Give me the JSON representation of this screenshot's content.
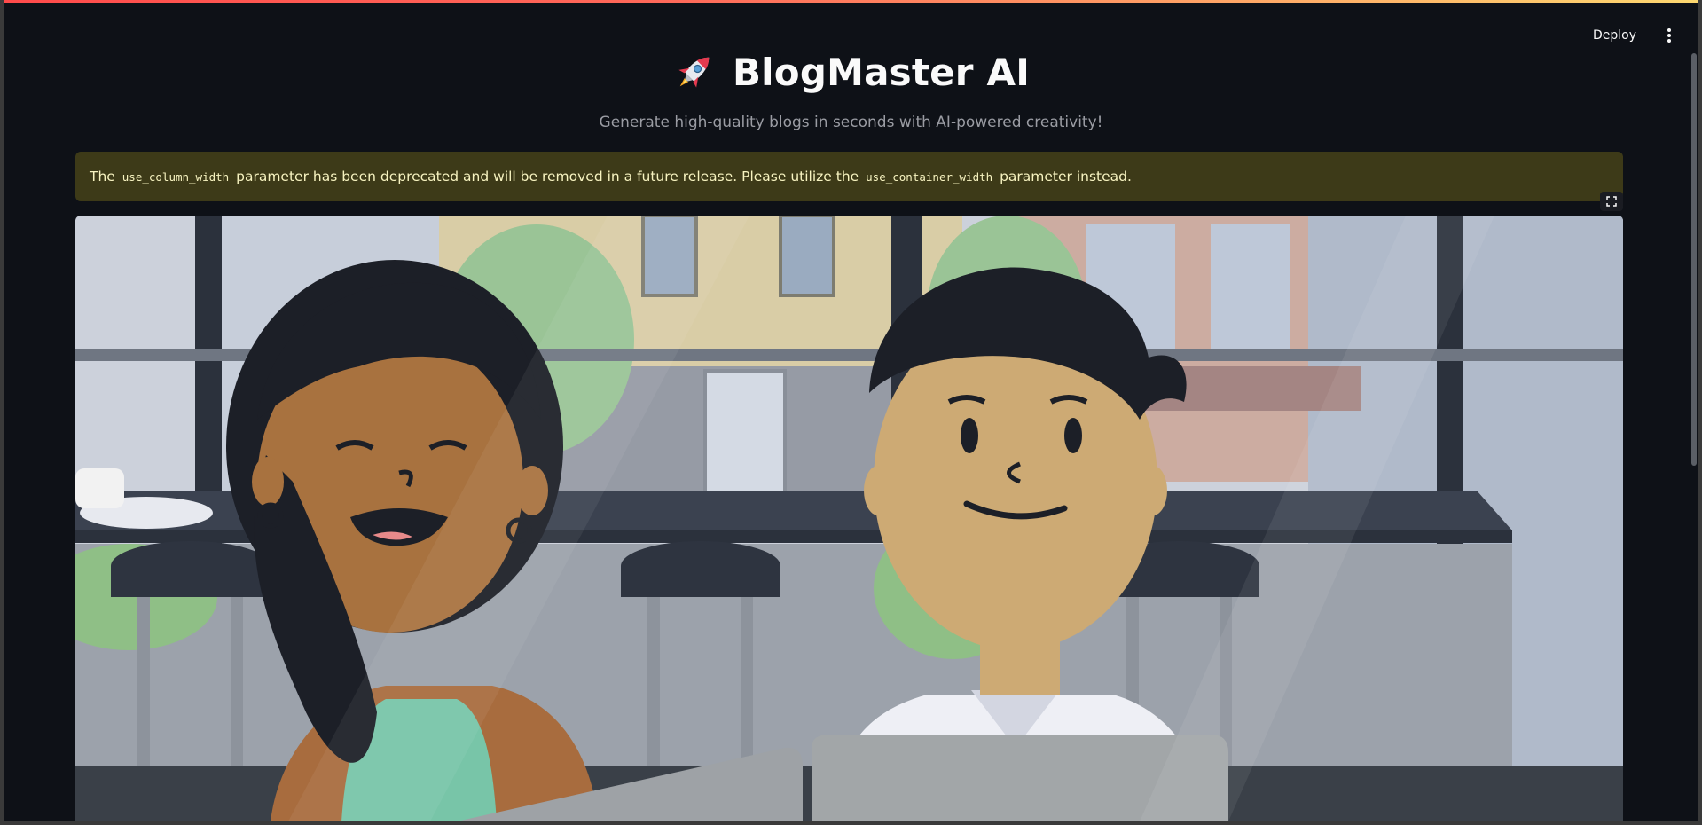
{
  "header": {
    "deploy_label": "Deploy",
    "menu_icon": "vertical-ellipsis-icon"
  },
  "main": {
    "title_icon": "rocket-icon",
    "title": "BlogMaster AI",
    "subtitle": "Generate high-quality blogs in seconds with AI-powered creativity!"
  },
  "alert": {
    "part1": "The",
    "code1": "use_column_width",
    "part2": "parameter has been deprecated and will be removed in a future release. Please utilize the",
    "code2": "use_container_width",
    "part3": "parameter instead."
  },
  "image": {
    "fullscreen_icon": "fullscreen-icon",
    "illustration": "two-people-cafe-illustration"
  },
  "colors": {
    "background": "#0e1117",
    "alert_bg": "#3d3a18",
    "alert_text": "#f7f3c0",
    "accent_gradient_start": "#ff4b4b",
    "accent_gradient_end": "#fdd870"
  }
}
